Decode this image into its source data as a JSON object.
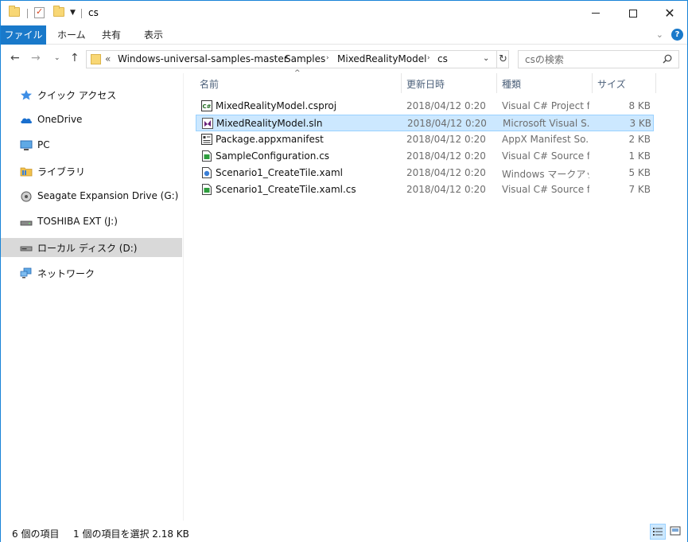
{
  "window": {
    "title": "cs",
    "accent_color": "#1979ca",
    "selection_color": "#cce8ff"
  },
  "ribbon": {
    "tabs": [
      {
        "label": "ファイル",
        "active": true
      },
      {
        "label": "ホーム"
      },
      {
        "label": "共有"
      },
      {
        "label": "表示"
      }
    ]
  },
  "nav": {
    "overflow": "«",
    "breadcrumb": [
      "Windows-universal-samples-master",
      "Samples",
      "MixedRealityModel",
      "cs"
    ],
    "search_placeholder": "csの検索"
  },
  "sidebar": {
    "items": [
      {
        "label": "クイック アクセス",
        "icon": "star-icon"
      },
      {
        "label": "OneDrive",
        "icon": "cloud-icon"
      },
      {
        "label": "PC",
        "icon": "monitor-icon"
      },
      {
        "label": "ライブラリ",
        "icon": "library-folder-icon"
      },
      {
        "label": "Seagate Expansion Drive (G:)",
        "icon": "disc-drive-icon"
      },
      {
        "label": "TOSHIBA EXT (J:)",
        "icon": "external-drive-icon"
      },
      {
        "label": "ローカル ディスク (D:)",
        "icon": "local-disk-icon",
        "selected": true
      },
      {
        "label": "ネットワーク",
        "icon": "network-icon"
      }
    ]
  },
  "columns": {
    "name": "名前",
    "date": "更新日時",
    "type": "種類",
    "size": "サイズ"
  },
  "files": [
    {
      "name": "MixedRealityModel.csproj",
      "date": "2018/04/12 0:20",
      "type": "Visual C# Project f...",
      "size": "8 KB",
      "icon": "csproj-icon"
    },
    {
      "name": "MixedRealityModel.sln",
      "date": "2018/04/12 0:20",
      "type": "Microsoft Visual S...",
      "size": "3 KB",
      "icon": "visual-studio-solution-icon",
      "selected": true
    },
    {
      "name": "Package.appxmanifest",
      "date": "2018/04/12 0:20",
      "type": "AppX Manifest So...",
      "size": "2 KB",
      "icon": "manifest-icon"
    },
    {
      "name": "SampleConfiguration.cs",
      "date": "2018/04/12 0:20",
      "type": "Visual C# Source file",
      "size": "1 KB",
      "icon": "cs-file-icon"
    },
    {
      "name": "Scenario1_CreateTile.xaml",
      "date": "2018/04/12 0:20",
      "type": "Windows マークアッ...",
      "size": "5 KB",
      "icon": "xaml-file-icon"
    },
    {
      "name": "Scenario1_CreateTile.xaml.cs",
      "date": "2018/04/12 0:20",
      "type": "Visual C# Source file",
      "size": "7 KB",
      "icon": "cs-file-icon"
    }
  ],
  "status": {
    "item_count": "6 個の項目",
    "selection": "1 個の項目を選択  2.18 KB"
  }
}
